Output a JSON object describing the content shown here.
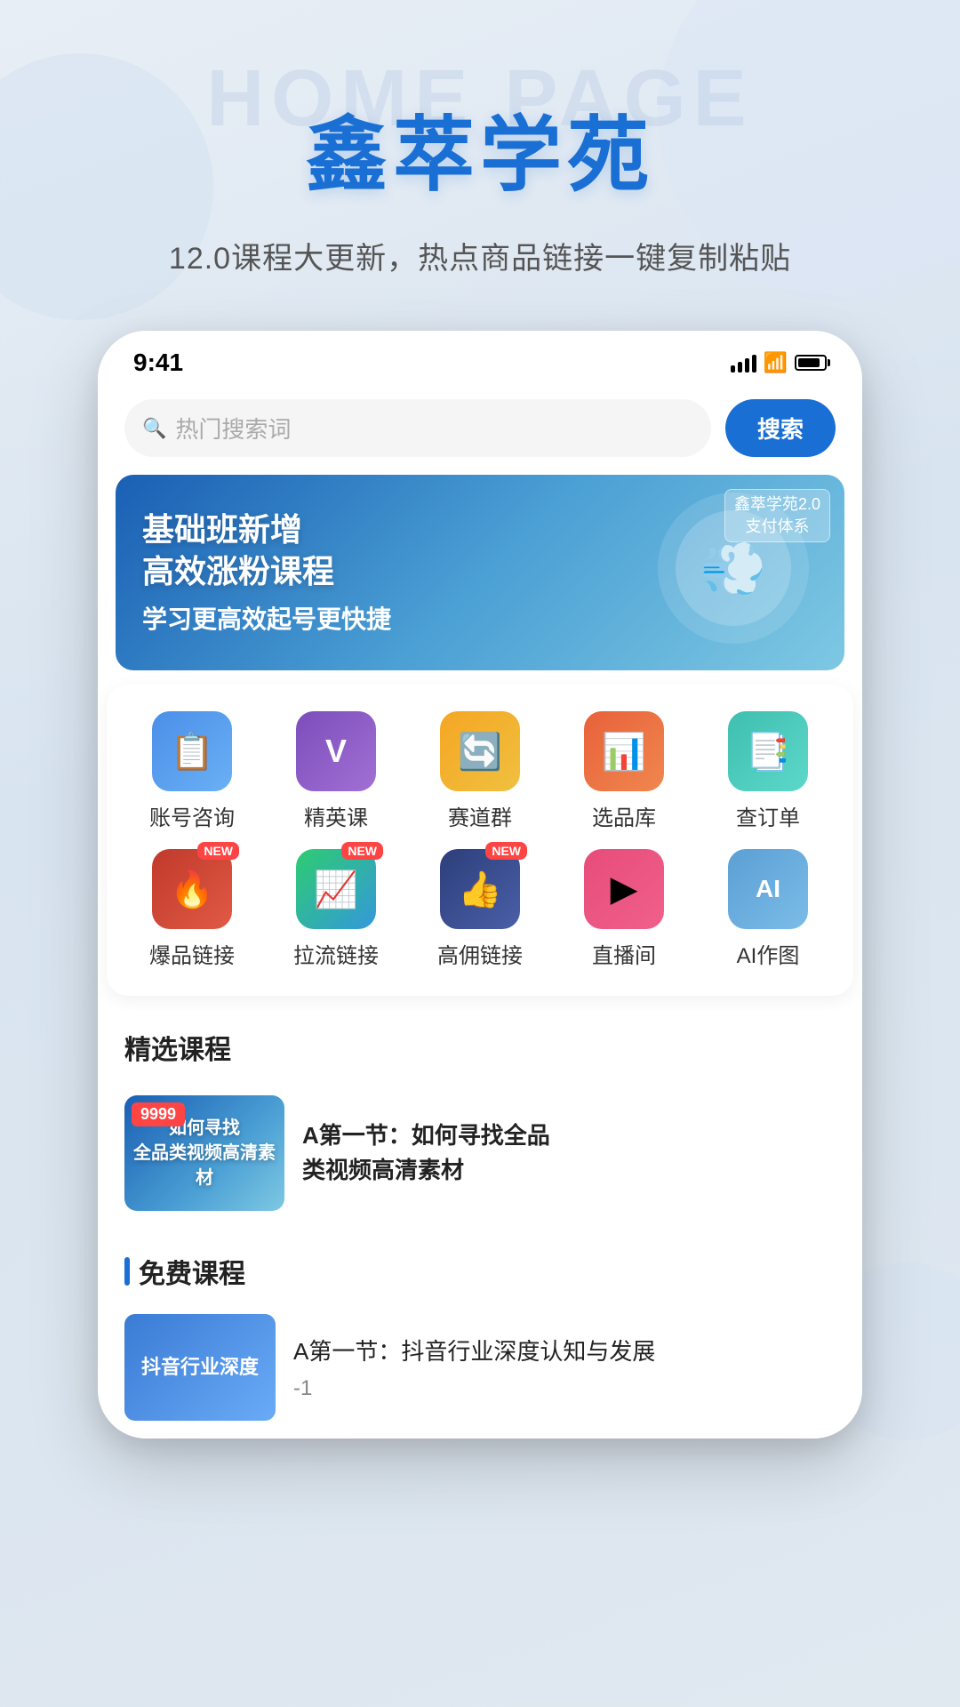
{
  "hero": {
    "bg_text": "HOME PAGE",
    "title": "鑫萃学苑",
    "subtitle": "12.0课程大更新，热点商品链接一键复制粘贴"
  },
  "status_bar": {
    "time": "9:41"
  },
  "search": {
    "placeholder": "热门搜索词",
    "button_label": "搜索"
  },
  "banner": {
    "title_line1": "基础班新增",
    "title_line2": "高效涨粉课程",
    "subtitle": "学习更高效起号更快捷",
    "badge_line1": "鑫萃学苑2.0",
    "badge_line2": "支付体系"
  },
  "menu": {
    "items": [
      {
        "id": "account",
        "label": "账号咨询",
        "color": "blue",
        "icon": "📋",
        "new": false
      },
      {
        "id": "elite",
        "label": "精英课",
        "color": "purple",
        "icon": "✔",
        "new": false
      },
      {
        "id": "race",
        "label": "赛道群",
        "color": "orange",
        "icon": "🔄",
        "new": false
      },
      {
        "id": "select",
        "label": "选品库",
        "color": "red-orange",
        "icon": "📊",
        "new": false
      },
      {
        "id": "order",
        "label": "查订单",
        "color": "teal",
        "icon": "📑",
        "new": false
      },
      {
        "id": "hot",
        "label": "爆品链接",
        "color": "red-dark",
        "icon": "🔥",
        "new": true
      },
      {
        "id": "pull",
        "label": "拉流链接",
        "color": "green-blue",
        "icon": "📈",
        "new": true
      },
      {
        "id": "high",
        "label": "高佣链接",
        "color": "dark-blue",
        "icon": "👍",
        "new": true
      },
      {
        "id": "live",
        "label": "直播间",
        "color": "pink-red",
        "icon": "▶",
        "new": false
      },
      {
        "id": "ai",
        "label": "AI作图",
        "color": "light-blue",
        "icon": "AI",
        "new": false
      }
    ]
  },
  "courses_section": {
    "title": "精选课程",
    "items": [
      {
        "badge": "9999",
        "thumb_text": "如何寻找\n全品类视频高清素材",
        "title": "A第一节：如何寻找全品\n类视频高清素材"
      }
    ]
  },
  "free_section": {
    "title": "免费课程",
    "items": [
      {
        "thumb_text": "抖音行业深度",
        "title": "A第一节：抖音行业深度认知与发展",
        "sub": "-1"
      }
    ]
  }
}
